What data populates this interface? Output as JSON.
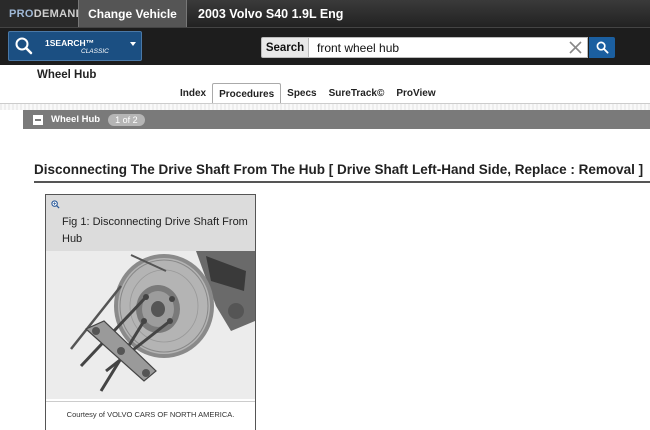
{
  "header": {
    "logo_pro": "PRO",
    "logo_demand": "DEMAND",
    "change_vehicle_label": "Change Vehicle",
    "vehicle_title": "2003 Volvo S40 1.9L Eng"
  },
  "search": {
    "mode_label": "1SEARCH™",
    "mode_sub": "CLASSIC",
    "button_label": "Search",
    "query": "front wheel hub"
  },
  "page": {
    "title": "Wheel Hub"
  },
  "tabs": [
    {
      "label": "Index",
      "active": false
    },
    {
      "label": "Procedures",
      "active": true
    },
    {
      "label": "Specs",
      "active": false
    },
    {
      "label": "SureTrack©",
      "active": false
    },
    {
      "label": "ProView",
      "active": false
    }
  ],
  "section": {
    "label": "Wheel Hub",
    "pager": "1 of 2"
  },
  "procedure": {
    "heading": "Disconnecting The Drive Shaft From The Hub [ Drive Shaft Left-Hand Side, Replace : Removal ]"
  },
  "figure": {
    "caption": "Fig 1: Disconnecting Drive Shaft From Hub",
    "courtesy": "Courtesy of VOLVO CARS OF NORTH AMERICA."
  },
  "colors": {
    "accent_blue": "#1b5fa0",
    "topbar": "#2a2a2a",
    "section_bar": "#7a7a7a"
  }
}
